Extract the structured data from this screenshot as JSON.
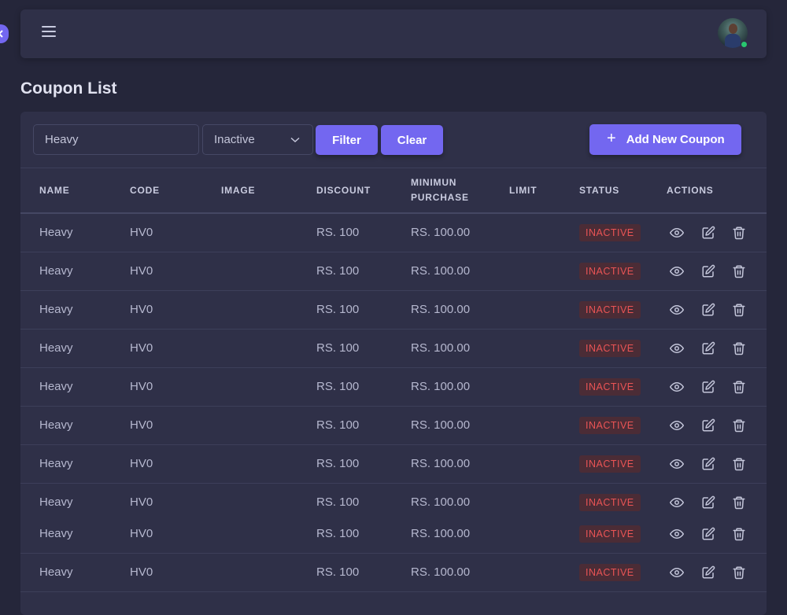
{
  "page": {
    "title": "Coupon List"
  },
  "toolbar": {
    "search_value": "Heavy",
    "status_selected": "Inactive",
    "filter_label": "Filter",
    "clear_label": "Clear",
    "add_label": "Add New Coupon"
  },
  "table": {
    "columns": [
      "NAME",
      "CODE",
      "IMAGE",
      "DISCOUNT",
      "MINIMUN PURCHASE",
      "LIMIT",
      "STATUS",
      "ACTIONS"
    ],
    "rows": [
      {
        "name": "Heavy",
        "code": "HV0",
        "image": "",
        "discount": "RS. 100",
        "min_purchase": "RS. 100.00",
        "limit": "",
        "status": "INACTIVE"
      },
      {
        "name": "Heavy",
        "code": "HV0",
        "image": "",
        "discount": "RS. 100",
        "min_purchase": "RS. 100.00",
        "limit": "",
        "status": "INACTIVE"
      },
      {
        "name": "Heavy",
        "code": "HV0",
        "image": "",
        "discount": "RS. 100",
        "min_purchase": "RS. 100.00",
        "limit": "",
        "status": "INACTIVE"
      },
      {
        "name": "Heavy",
        "code": "HV0",
        "image": "",
        "discount": "RS. 100",
        "min_purchase": "RS. 100.00",
        "limit": "",
        "status": "INACTIVE"
      },
      {
        "name": "Heavy",
        "code": "HV0",
        "image": "",
        "discount": "RS. 100",
        "min_purchase": "RS. 100.00",
        "limit": "",
        "status": "INACTIVE"
      },
      {
        "name": "Heavy",
        "code": "HV0",
        "image": "",
        "discount": "RS. 100",
        "min_purchase": "RS. 100.00",
        "limit": "",
        "status": "INACTIVE"
      },
      {
        "name": "Heavy",
        "code": "HV0",
        "image": "",
        "discount": "RS. 100",
        "min_purchase": "RS. 100.00",
        "limit": "",
        "status": "INACTIVE"
      },
      {
        "name": "Heavy",
        "code": "HV0",
        "image": "",
        "discount": "RS. 100",
        "min_purchase": "RS. 100.00",
        "limit": "",
        "status": "INACTIVE"
      },
      {
        "name": "Heavy",
        "code": "HV0",
        "image": "",
        "discount": "RS. 100",
        "min_purchase": "RS. 100.00",
        "limit": "",
        "status": "INACTIVE"
      },
      {
        "name": "Heavy",
        "code": "HV0",
        "image": "",
        "discount": "RS. 100",
        "min_purchase": "RS. 100.00",
        "limit": "",
        "status": "INACTIVE"
      }
    ]
  },
  "icons": {
    "menu": "hamburger-menu-icon",
    "collapse": "chevron-left-icon",
    "select": "chevron-down-icon",
    "add": "plus-icon",
    "view": "eye-icon",
    "edit": "edit-icon",
    "delete": "trash-icon"
  },
  "colors": {
    "accent": "#7367f0",
    "background": "#25263a",
    "card": "#2f3048",
    "inactive_text": "#ea5455",
    "inactive_bg": "#4b2c36",
    "online": "#28c76f"
  }
}
